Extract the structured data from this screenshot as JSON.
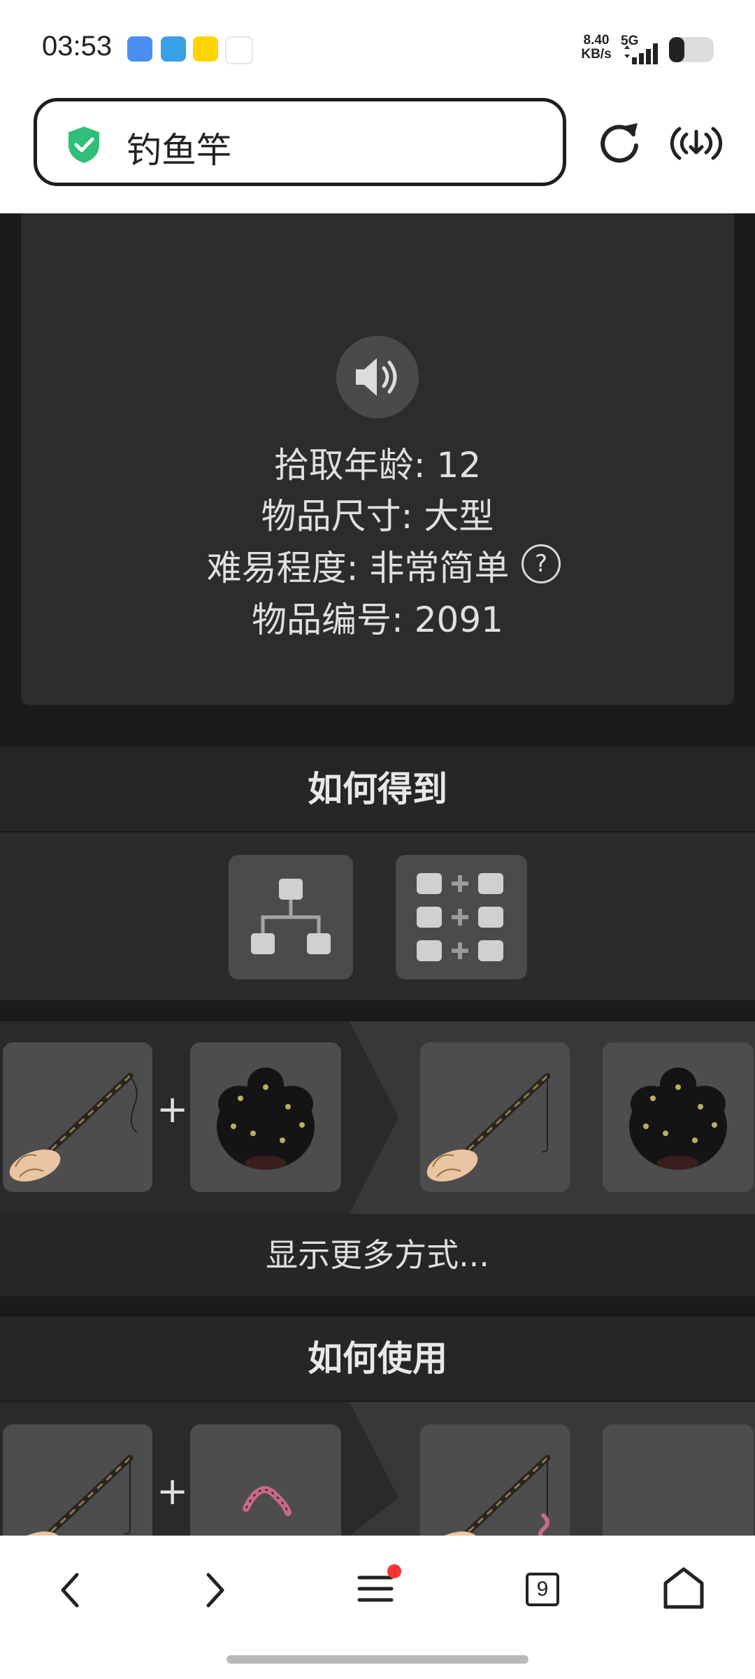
{
  "status_bar": {
    "time": "03:53",
    "net_speed_value": "8.40",
    "net_speed_unit": "KB/s",
    "network": "5G",
    "notification_icons": [
      "baidu-netdisk-icon",
      "telegram-icon",
      "manga-app-icon",
      "app-icon"
    ]
  },
  "address_bar": {
    "url_text": "钓鱼竿",
    "shield_color": "#2fbf7a"
  },
  "item_info": {
    "pickup_age": "拾取年龄: 12",
    "item_size": "物品尺寸: 大型",
    "difficulty": "难易程度: 非常简单",
    "item_id": "物品编号: 2091",
    "help_symbol": "?"
  },
  "how_to_get": {
    "title": "如何得到",
    "recipe": {
      "inputs": [
        "fishing-rod",
        "berry-bush"
      ],
      "outputs": [
        "fishing-rod-with-hook",
        "berry-bush"
      ]
    },
    "plus": "+",
    "show_more": "显示更多方式..."
  },
  "how_to_use": {
    "title": "如何使用",
    "recipe": {
      "inputs": [
        "fishing-rod",
        "worm"
      ],
      "outputs": [
        "baited-fishing-rod",
        ""
      ]
    },
    "plus": "+"
  },
  "bottom_nav": {
    "tab_count": "9",
    "menu_badge_color": "#ff3333"
  }
}
